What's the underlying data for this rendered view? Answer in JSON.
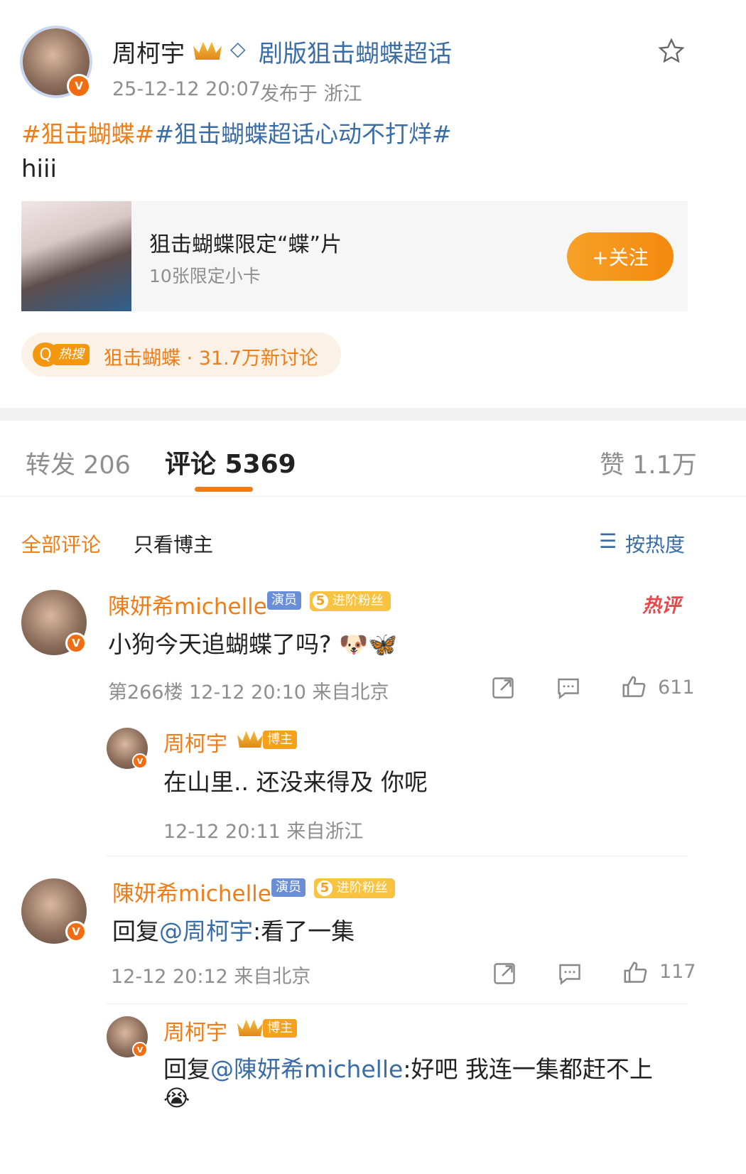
{
  "post": {
    "author": "周柯宇",
    "supertopic": "剧版狙击蝴蝶超话",
    "time": "25-12-12 20:07",
    "location": "发布于 浙江",
    "hashtag1": "#狙击蝴蝶#",
    "hashtag2": "#狙击蝴蝶超话心动不打烊#",
    "text": "hiii",
    "card": {
      "title": "狙击蝴蝶限定“蝶”片",
      "subtitle": "10张限定小卡",
      "button": "+关注"
    },
    "hot": {
      "badge": "热搜",
      "text": "狙击蝴蝶 · 31.7万新讨论"
    }
  },
  "tabs": {
    "repost": "转发 206",
    "comments": "评论 5369",
    "likes": "赞 1.1万"
  },
  "filters": {
    "all": "全部评论",
    "author_only": "只看博主",
    "sort": "按热度"
  },
  "comments": [
    {
      "name": "陳妍希michelle",
      "role_tag": "演员",
      "fan_level": "5",
      "fan_tag": "进阶粉丝",
      "hot_label": "热评",
      "text": "小狗今天追蝴蝶了吗?",
      "emoji": "🐶🦋",
      "meta": "第266楼 12-12 20:10 来自北京",
      "likes": "611",
      "reply": {
        "name": "周柯宇",
        "tag": "博主",
        "text": "在山里.. 还没来得及 你呢",
        "meta": "12-12 20:11 来自浙江"
      }
    },
    {
      "name": "陳妍希michelle",
      "role_tag": "演员",
      "fan_level": "5",
      "fan_tag": "进阶粉丝",
      "text_prefix": "回复",
      "mention": "@周柯宇",
      "text": ":看了一集",
      "meta": "12-12 20:12 来自北京",
      "likes": "117",
      "reply": {
        "name": "周柯宇",
        "tag": "博主",
        "text_prefix": "回复",
        "mention": "@陳妍希michelle",
        "text": ":好吧 我连一集都赶不上",
        "emoji": "😭"
      }
    }
  ],
  "colors": {
    "accent": "#ef7d17",
    "link": "#3a6da6",
    "gray": "#8e8e8e"
  }
}
